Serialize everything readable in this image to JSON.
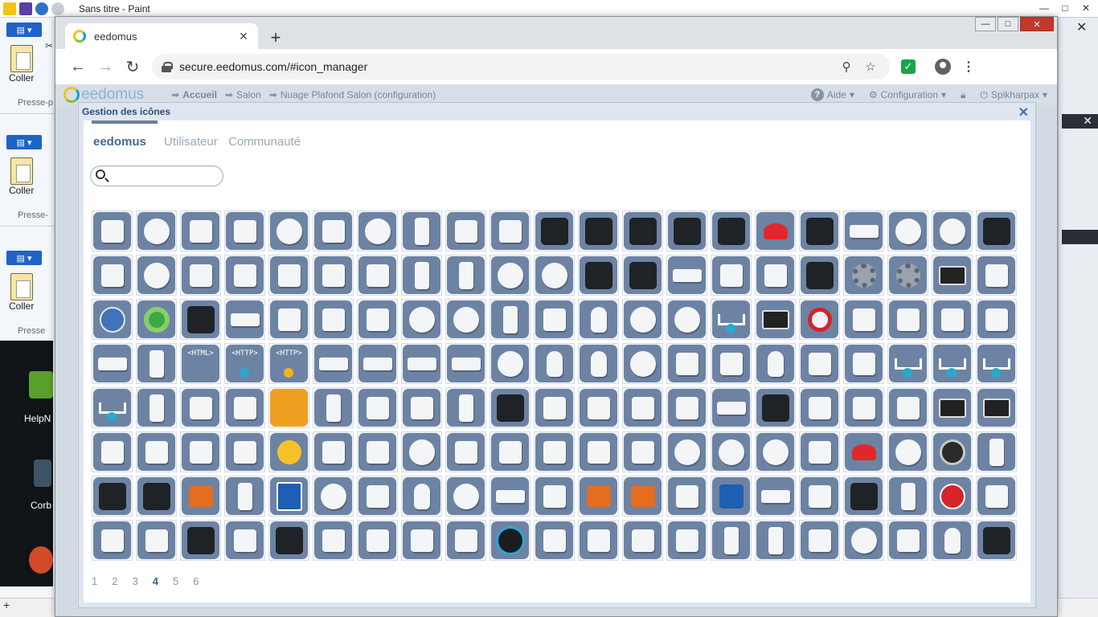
{
  "paint": {
    "title": "Sans titre - Paint",
    "coller_label": "Coller",
    "presse_label": "Presse-p",
    "presse_label2": "Presse-",
    "presse_label3": "Presse",
    "desktop": {
      "icon1_label": "HelpN",
      "icon2_label": "Corb"
    },
    "status_plus": "+"
  },
  "browser": {
    "tab_title": "eedomus",
    "url": "secure.eedomus.com/#icon_manager"
  },
  "eedomus": {
    "logo": "eedomus",
    "breadcrumb": [
      "Accueil",
      "Salon",
      "Nuage Plafond Salon (configuration)"
    ],
    "header_right": {
      "help": "Aide",
      "config": "Configuration",
      "user": "Spikharpax"
    }
  },
  "dialog": {
    "title": "Gestion des icônes",
    "tabs": [
      "eedomus",
      "Utilisateur",
      "Communauté"
    ],
    "active_tab": "eedomus",
    "search_placeholder": "",
    "pages": [
      "1",
      "2",
      "3",
      "4",
      "5",
      "6"
    ],
    "current_page": "4"
  },
  "icons": [
    [
      "thermostat-valve",
      "siren",
      "light-switch",
      "motion-sensor",
      "smoke-detector",
      "module-box",
      "thermostat-round",
      "door-sensor",
      "window-sensor",
      "roof-window",
      "dimmer-module",
      "eye-sensor",
      "relay-module",
      "relay-switch",
      "relay-switch-2",
      "red-button",
      "door-contact",
      "contact-sensor",
      "ceiling-light",
      "smoke-alarm",
      "rgbw-controller"
    ],
    [
      "keypad",
      "smoke-detector-2",
      "smartphone-app",
      "valve-head",
      "relay-board",
      "wall-socket",
      "dimmer-wall",
      "door-sensor-tall",
      "curtain-sensor",
      "siren-outdoor",
      "alarm-siren",
      "display-panel",
      "router",
      "module-flat",
      "blind-module",
      "plug-module",
      "lcd-display",
      "dev-actionneur",
      "dev-capteur",
      "wall-thermostat",
      "google-home"
    ],
    [
      "globe",
      "green-dome",
      "remote-pad",
      "led-bar",
      "power-box",
      "cable-sensor",
      "cable-sensor-2",
      "dome-sensor",
      "motion-ball",
      "door-sensor-white",
      "smart-plug",
      "bulb",
      "hub-dome",
      "remote-round",
      "heartbeat",
      "thermostat-display",
      "ring-siren",
      "scene-controller",
      "thermostat-panel",
      "wall-switch",
      "wall-dimmer"
    ],
    [
      "magnet-sensor",
      "cylinder-sensor",
      "html-file",
      "http-blue",
      "http-yellow",
      "usb-key",
      "usb-stick",
      "bar-module",
      "flat-box",
      "round-panel",
      "candle-bulb",
      "bulb-2",
      "egg-sensor",
      "socket-adapter",
      "plug-black",
      "bulb-3",
      "panel-dots",
      "signal-plug",
      "wave-sine",
      "wave-square",
      "wave-square-2"
    ],
    [
      "wave-step",
      "door-sensor-slim",
      "ghost",
      "connector-module",
      "vibration-sensor",
      "remote-tall",
      "weather-station",
      "display-sensor",
      "slim-sensor",
      "lcd-thermo",
      "speaker",
      "wall-outlet",
      "timer-panel",
      "module-red",
      "led-strip",
      "radio",
      "touch-switch",
      "touch-switch-2",
      "touch-switch-4",
      "wall-thermo-dark",
      "wall-thermo-display"
    ],
    [
      "thermostat-white",
      "thermostat-black",
      "robot",
      "valve-silver",
      "weather-sun",
      "wall-plate",
      "cube-sensor",
      "disc-light",
      "remote-square",
      "remote-cross",
      "glass-panel",
      "glass-switch",
      "glass-switch-2",
      "cloud-sensor",
      "sensor-round",
      "dome-white",
      "wall-socket-2",
      "remote-red",
      "round-button",
      "nest-thermostat",
      "door-sensor-long"
    ],
    [
      "camera-outdoor",
      "camera-outdoor-2",
      "panel-orange",
      "pillar-light",
      "nfc-tag",
      "ring-lamp",
      "square-panel",
      "bulb-purple",
      "dial-remote",
      "button-bar",
      "socket-plug",
      "relay-orange",
      "relay-orange-2",
      "wifi-panel",
      "blue-module",
      "switch-long",
      "double-switch",
      "cable-box",
      "sensor-cable",
      "zwave-logo",
      "key-sketch"
    ],
    [
      "box-sensor",
      "weather-display",
      "lcd-thermometer",
      "cube-display",
      "lcd-sensor",
      "wall-display",
      "small-sensor",
      "pool-sensor",
      "vase-sensor",
      "hub-black",
      "euro-socket",
      "digital-counter",
      "relay-terminal",
      "in-wall-plug",
      "stick-sensor",
      "slim-sensor-2",
      "terminal-module",
      "round-fan",
      "led-panel",
      "bulb-hue",
      "av-receiver"
    ]
  ]
}
